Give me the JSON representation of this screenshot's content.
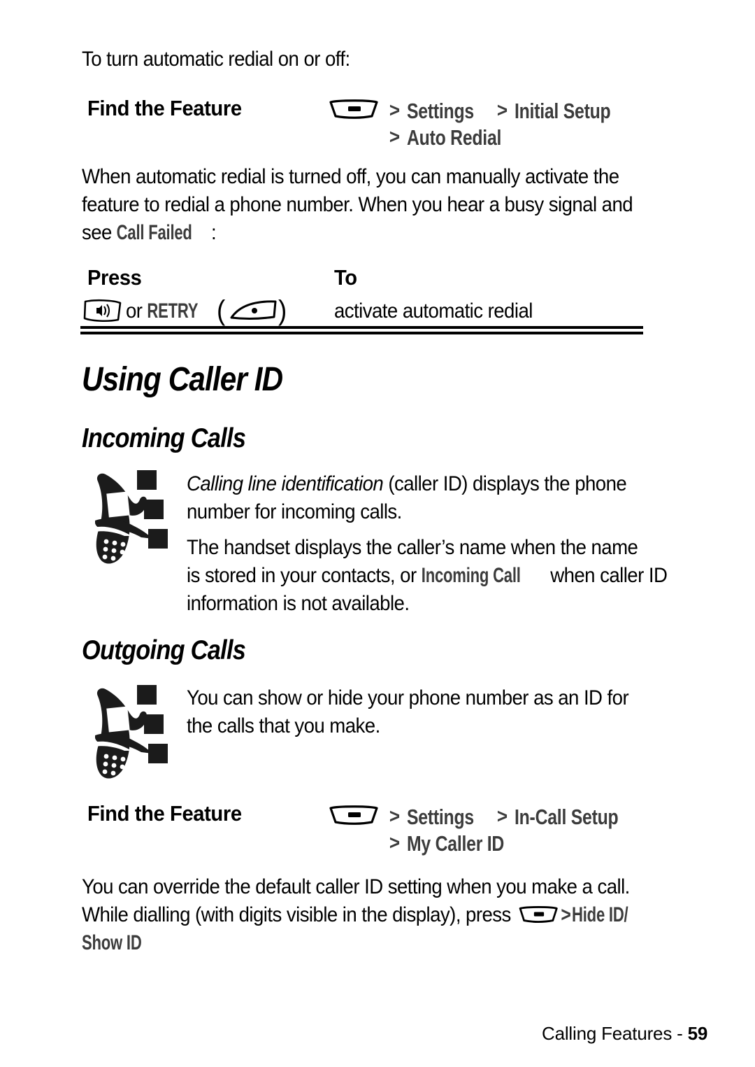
{
  "page": {
    "intro_line": "To turn automatic redial on or off:",
    "footer_text": "Calling Features - ",
    "footer_page": "59"
  },
  "labels": {
    "find_the_feature": "Find the Feature",
    "press": "Press",
    "to": "To"
  },
  "find_feature_1": {
    "menu_icon": "menu-key-icon",
    "gt": ">",
    "item1": "Settings",
    "item2": "Initial Setup",
    "item3": "Auto Redial"
  },
  "paragraph_1": {
    "line1": "When automatic redial is turned off, you can manually activate the",
    "line2": "feature to redial a phone number. When you hear a busy signal and",
    "line3_pre": "see ",
    "line3_term": "Call Failed",
    "line3_post": ":"
  },
  "press_table": {
    "key_icon": "voice-key-icon",
    "or": " or ",
    "retry_label": "RETRY",
    "paren_open": "(",
    "softkey_icon": "soft-key-icon",
    "paren_close": ")",
    "action": "activate automatic redial"
  },
  "headings": {
    "h1_using_caller_id": "Using Caller ID",
    "h2_incoming_calls": "Incoming Calls",
    "h2_outgoing_calls": "Outgoing Calls"
  },
  "incoming": {
    "phone_icon": "flip-phone-icon",
    "p1_italic": "Calling line identification",
    "p1_rest": " (caller ID) displays the phone",
    "p1_line2": "number for incoming calls.",
    "p2_line1": "The handset displays the caller’s name when the name",
    "p2_line2_pre": "is stored in your contacts, or ",
    "p2_line2_term": "Incoming Call",
    "p2_line2_post": " when caller ID",
    "p2_line3": "information is not available."
  },
  "outgoing": {
    "phone_icon": "flip-phone-icon",
    "p1_line1": "You can show or hide your phone number as an ID for",
    "p1_line2": "the calls that you make."
  },
  "find_feature_2": {
    "menu_icon": "menu-key-icon",
    "gt": ">",
    "item1": "Settings",
    "item2": "In-Call Setup",
    "item3": "My Caller ID"
  },
  "paragraph_2": {
    "line1": "You can override the default caller ID setting when you make a call.",
    "line2_pre": "While dialling (with digits visible in the display), press ",
    "line2_gt": ">",
    "line2_term": "Hide ID/",
    "line3_term": "Show ID"
  },
  "colors": {
    "ink": "#000000",
    "term_gray": "#3c3c3c",
    "paper": "#ffffff"
  }
}
